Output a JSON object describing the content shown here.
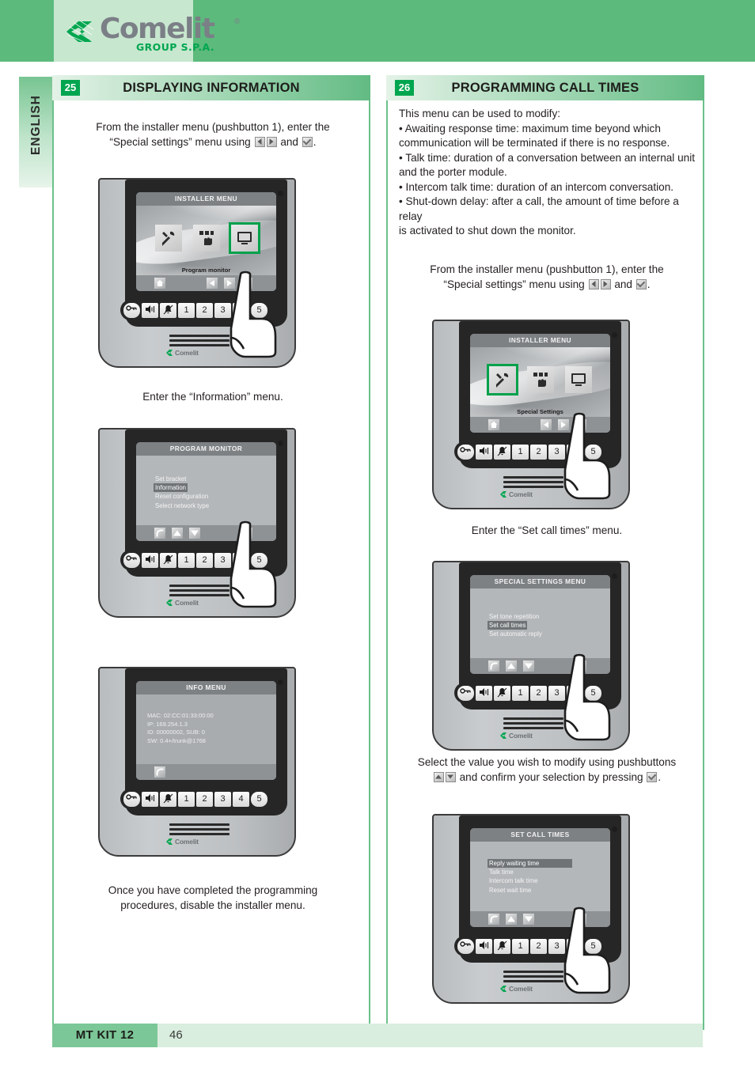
{
  "brand": {
    "name": "Comelit",
    "registered": "®",
    "subtitle": "GROUP S.P.A.",
    "green": "#00a64f",
    "banner_green": "#5cba7d"
  },
  "language_tab": {
    "label": "ENGLISH"
  },
  "sections": {
    "left": {
      "number": "25",
      "title": "DISPLAYING INFORMATION",
      "intro_line1": "From the installer menu (pushbutton 1), enter the",
      "intro_line2_a": "“Special settings” menu using",
      "intro_line2_b": "and",
      "intro_line2_c": ".",
      "caption_information": "Enter the “Information” menu.",
      "closing_line1": "Once you have completed the programming",
      "closing_line2": "procedures, disable the installer menu."
    },
    "right": {
      "number": "26",
      "title": "PROGRAMMING CALL TIMES",
      "bullets": [
        "This menu can be used to modify:",
        "• Awaiting response time: maximum time beyond which",
        "communication will be terminated if there is no response.",
        "• Talk time: duration of a conversation between an internal unit",
        "and the porter module.",
        "• Intercom talk time: duration of an intercom conversation.",
        "• Shut-down delay: after a call, the amount of time before a relay",
        "is activated to shut down the monitor."
      ],
      "intro_line1": "From the installer menu (pushbutton 1), enter the",
      "intro_line2_a": "“Special settings” menu using",
      "intro_line2_b": "and",
      "intro_line2_c": ".",
      "caption_set_call_times": "Enter the “Set call times” menu.",
      "select_line1": "Select the value you wish to modify using pushbuttons",
      "select_line2_a": "and confirm your selection by pressing",
      "select_line2_b": "."
    }
  },
  "devices": {
    "installer_program": {
      "screen_title": "INSTALLER MENU",
      "selected_label": "Program monitor",
      "icons": [
        "tools-icon",
        "keypad-hand-icon",
        "monitor-icon"
      ],
      "selected_index": 2,
      "softkeys": [
        "home-icon",
        "prev-icon",
        "next-icon",
        "ok-icon"
      ],
      "keys": [
        "key-icon",
        "speaker-icon",
        "bell-mute-icon",
        "1",
        "2",
        "3",
        "4",
        "5"
      ],
      "pressed_key": "4",
      "brand": "Comelit"
    },
    "program_monitor": {
      "screen_title": "PROGRAM MONITOR",
      "items": [
        "Set bracket",
        "Information",
        "Reset configuration",
        "Select network type"
      ],
      "highlighted": "Information",
      "softkeys": [
        "back-icon",
        "up-icon",
        "down-icon",
        "ok-icon"
      ],
      "keys": [
        "key-icon",
        "speaker-icon",
        "bell-mute-icon",
        "1",
        "2",
        "3",
        "4",
        "5"
      ],
      "pressed_key": "4",
      "brand": "Comelit"
    },
    "info_menu": {
      "screen_title": "INFO MENU",
      "lines": [
        "MAC: 02:CC:01:33:00:00",
        "IP: 169.254.1.3",
        "ID: 00000002, SUB: 0",
        "SW: 0.4+/trunk@1768"
      ],
      "softkeys": [
        "back-icon"
      ],
      "keys": [
        "key-icon",
        "speaker-icon",
        "bell-mute-icon",
        "1",
        "2",
        "3",
        "4",
        "5"
      ],
      "pressed_key": "",
      "brand": "Comelit"
    },
    "installer_special": {
      "screen_title": "INSTALLER MENU",
      "selected_label": "Special Settings",
      "icons": [
        "tools-icon",
        "keypad-hand-icon",
        "monitor-icon"
      ],
      "selected_index": 0,
      "softkeys": [
        "home-icon",
        "prev-icon",
        "next-icon",
        "ok-icon"
      ],
      "keys": [
        "key-icon",
        "speaker-icon",
        "bell-mute-icon",
        "1",
        "2",
        "3",
        "4",
        "5"
      ],
      "pressed_key": "4",
      "brand": "Comelit"
    },
    "special_settings": {
      "screen_title": "SPECIAL SETTINGS MENU",
      "items": [
        "Set tone repetition",
        "Set call times",
        "Set automatic reply"
      ],
      "highlighted": "Set call times",
      "softkeys": [
        "back-icon",
        "up-icon",
        "down-icon",
        "ok-icon"
      ],
      "keys": [
        "key-icon",
        "speaker-icon",
        "bell-mute-icon",
        "1",
        "2",
        "3",
        "4",
        "5"
      ],
      "pressed_key": "4",
      "brand": "Comelit"
    },
    "set_call_times": {
      "screen_title": "SET CALL TIMES",
      "items": [
        "Reply waiting time",
        "Talk time",
        "Intercom talk time",
        "Reset wait time"
      ],
      "highlighted": "Reply waiting time",
      "softkeys": [
        "back-icon",
        "up-icon",
        "down-icon",
        "ok-icon"
      ],
      "keys": [
        "key-icon",
        "speaker-icon",
        "bell-mute-icon",
        "1",
        "2",
        "3",
        "4",
        "5"
      ],
      "pressed_key": "4",
      "brand": "Comelit"
    }
  },
  "footer": {
    "kit": "MT KIT 12",
    "page": "46"
  }
}
